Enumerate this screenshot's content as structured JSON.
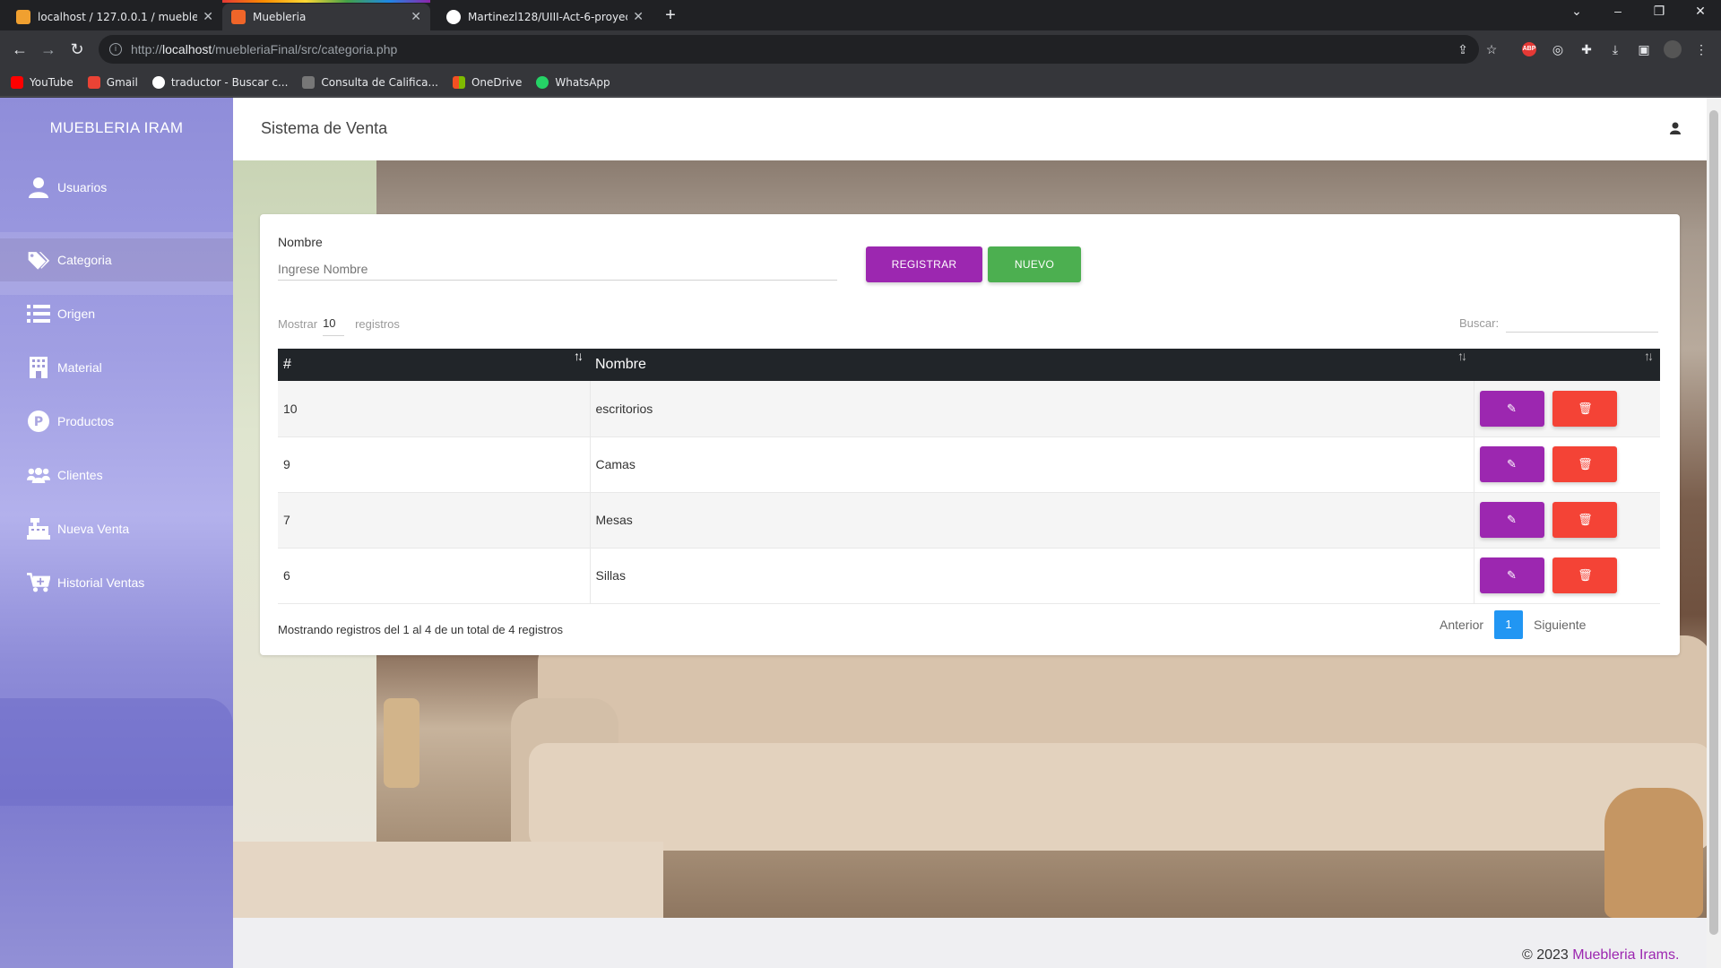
{
  "browser": {
    "tabs": [
      {
        "title": "localhost / 127.0.0.1 / muebleria",
        "active": false
      },
      {
        "title": "Muebleria",
        "active": true
      },
      {
        "title": "Martinezl128/UIII-Act-6-proyect",
        "active": false
      }
    ],
    "url_prefix": "http://",
    "url_host": "localhost",
    "url_path": "/muebleriaFinal/src/categoria.php",
    "bookmarks": [
      "YouTube",
      "Gmail",
      "traductor - Buscar c...",
      "Consulta de Califica...",
      "OneDrive",
      "WhatsApp"
    ]
  },
  "sidebar": {
    "brand": "MUEBLERIA IRAM",
    "items": [
      {
        "label": "Usuarios",
        "icon": "user-icon"
      },
      {
        "label": "Categoria",
        "icon": "tags-icon"
      },
      {
        "label": "Origen",
        "icon": "list-icon"
      },
      {
        "label": "Material",
        "icon": "building-icon"
      },
      {
        "label": "Productos",
        "icon": "product-p-icon"
      },
      {
        "label": "Clientes",
        "icon": "users-icon"
      },
      {
        "label": "Nueva Venta",
        "icon": "cash-register-icon"
      },
      {
        "label": "Historial Ventas",
        "icon": "cart-plus-icon"
      }
    ]
  },
  "header": {
    "title": "Sistema de Venta"
  },
  "form": {
    "label": "Nombre",
    "placeholder": "Ingrese Nombre",
    "register_label": "REGISTRAR",
    "new_label": "NUEVO"
  },
  "table_controls": {
    "show_label": "Mostrar",
    "show_value": "10",
    "records_label": "registros",
    "search_label": "Buscar:"
  },
  "table": {
    "headers": [
      "#",
      "Nombre",
      ""
    ],
    "rows": [
      {
        "id": "10",
        "nombre": "escritorios"
      },
      {
        "id": "9",
        "nombre": "Camas"
      },
      {
        "id": "7",
        "nombre": "Mesas"
      },
      {
        "id": "6",
        "nombre": "Sillas"
      }
    ]
  },
  "pagination": {
    "info": "Mostrando registros del 1 al 4 de un total de 4 registros",
    "prev": "Anterior",
    "page": "1",
    "next": "Siguiente"
  },
  "footer": {
    "prefix": "© 2023 ",
    "brand": "Muebleria Irams."
  },
  "colors": {
    "primary": "#9c27b0",
    "success": "#4caf50",
    "danger": "#f44336",
    "info": "#2196f3",
    "table_head": "#212529"
  }
}
